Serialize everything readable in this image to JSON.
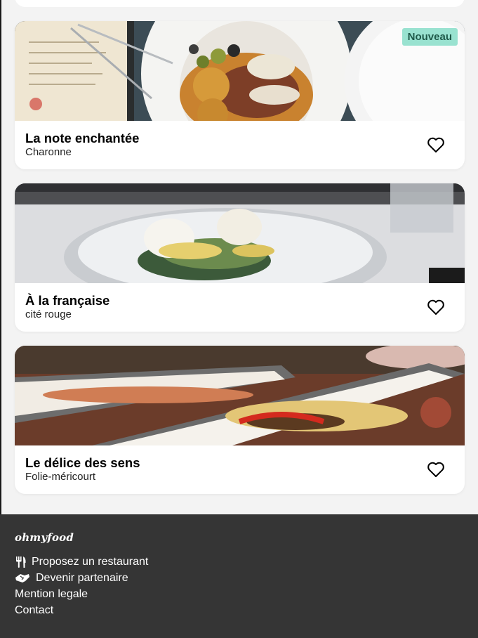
{
  "restaurants": [
    {
      "name": "La note enchantée",
      "area": "Charonne",
      "badge": "Nouveau"
    },
    {
      "name": "À la française",
      "area": "cité rouge"
    },
    {
      "name": "Le délice des sens",
      "area": "Folie-méricourt"
    }
  ],
  "footer": {
    "brand": "ohmyfood",
    "links": [
      {
        "label": "Proposez un restaurant",
        "icon": "utensils-icon"
      },
      {
        "label": "Devenir partenaire",
        "icon": "handshake-icon"
      },
      {
        "label": "Mention legale"
      },
      {
        "label": "Contact"
      }
    ]
  },
  "colors": {
    "badge_bg": "#99e2d0",
    "badge_text": "#1f5a4a",
    "footer_bg": "#353535",
    "page_bg": "#f3f3f3"
  }
}
